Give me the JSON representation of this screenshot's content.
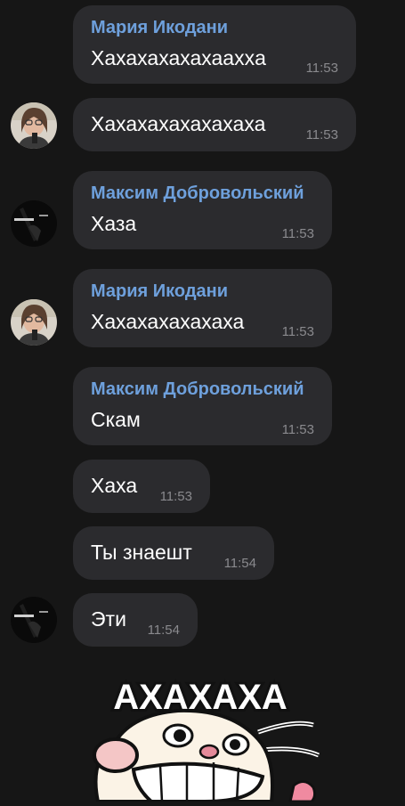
{
  "messages": [
    {
      "sender": "Мария Икодани",
      "text": "Хахахахахахааххa",
      "time": "11:53"
    },
    {
      "sender": "",
      "text": "Хахахахахахахаха",
      "time": "11:53"
    },
    {
      "sender": "Максим Добровольский",
      "text": "Хаза",
      "time": "11:53"
    },
    {
      "sender": "Мария Икодани",
      "text": "Хахахахахахаха",
      "time": "11:53"
    },
    {
      "sender": "Максим Добровольский",
      "text": "Скам",
      "time": "11:53"
    },
    {
      "sender": "",
      "text": "Хаха",
      "time": "11:53"
    },
    {
      "sender": "",
      "text": "Ты знаешт",
      "time": "11:54"
    },
    {
      "sender": "",
      "text": "Эти",
      "time": "11:54"
    }
  ],
  "sticker": {
    "text": "АХАХАХА"
  },
  "avatars": {
    "maria": "maria-avatar",
    "maksim": "maksim-avatar"
  }
}
